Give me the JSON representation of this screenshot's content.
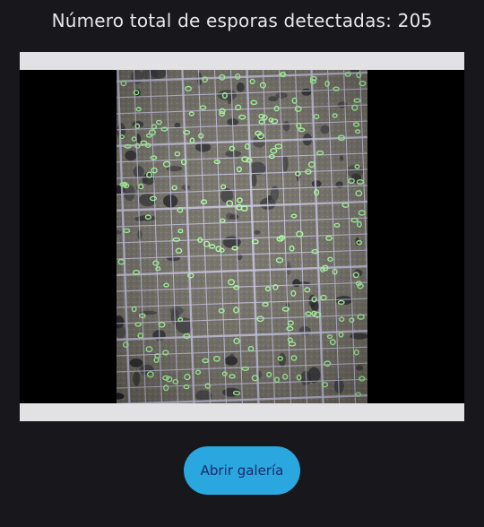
{
  "screen": {
    "title": "Número total de esporas detectadas: 205",
    "spore_count": 205
  },
  "image": {
    "description_icon": "microscope-image",
    "marker_color": "#a8ff9e",
    "grid_color": "#c9c7e6",
    "background_color": "#7d7a70"
  },
  "actions": {
    "gallery_button_label": "Abrir galería",
    "gallery_button_color": "#2aa7df"
  }
}
